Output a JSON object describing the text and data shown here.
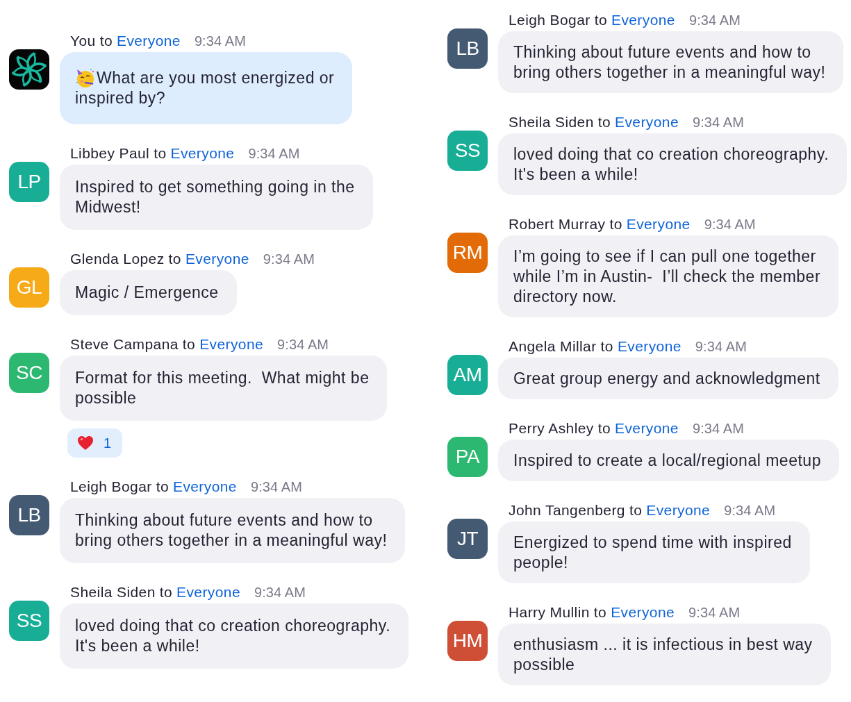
{
  "columns": [
    {
      "messages": [
        {
          "sender": "You",
          "connector": "to",
          "recipient": "Everyone",
          "time": "9:34 AM",
          "own": true,
          "avatar": {
            "kind": "logo"
          },
          "lead_emoji": {
            "kind": "party"
          },
          "lines": [
            "What are you most energized or",
            "inspired by?"
          ]
        },
        {
          "sender": "Libbey Paul",
          "connector": "to",
          "recipient": "Everyone",
          "time": "9:34 AM",
          "own": false,
          "avatar": {
            "kind": "initials",
            "text": "LP",
            "color": "#18ae96"
          },
          "lines": [
            "Inspired to get something going in the",
            "Midwest!"
          ]
        },
        {
          "sender": "Glenda Lopez",
          "connector": "to",
          "recipient": "Everyone",
          "time": "9:34 AM",
          "own": false,
          "avatar": {
            "kind": "initials",
            "text": "GL",
            "color": "#f6aa17"
          },
          "lines": [
            "Magic / Emergence"
          ]
        },
        {
          "sender": "Steve Campana",
          "connector": "to",
          "recipient": "Everyone",
          "time": "9:34 AM",
          "own": false,
          "avatar": {
            "kind": "initials",
            "text": "SC",
            "color": "#2db872"
          },
          "lines": [
            "Format for this meeting.  What might be",
            "possible"
          ],
          "reactions": [
            {
              "kind": "heart",
              "count": "1"
            }
          ]
        },
        {
          "sender": "Leigh Bogar",
          "connector": "to",
          "recipient": "Everyone",
          "time": "9:34 AM",
          "own": false,
          "avatar": {
            "kind": "initials",
            "text": "LB",
            "color": "#445a72"
          },
          "lines": [
            "Thinking about future events and how to",
            "bring others together in a meaningful way!"
          ]
        },
        {
          "sender": "Sheila Siden",
          "connector": "to",
          "recipient": "Everyone",
          "time": "9:34 AM",
          "own": false,
          "avatar": {
            "kind": "initials",
            "text": "SS",
            "color": "#18ae96"
          },
          "lines": [
            "loved doing that co creation choreography.",
            "It's been a while!"
          ]
        }
      ]
    },
    {
      "messages": [
        {
          "sender": "Leigh Bogar",
          "connector": "to",
          "recipient": "Everyone",
          "time": "9:34 AM",
          "own": false,
          "avatar": {
            "kind": "initials",
            "text": "LB",
            "color": "#445a72"
          },
          "lines": [
            "Thinking about future events and how to",
            "bring others together in a meaningful way!"
          ]
        },
        {
          "sender": "Sheila Siden",
          "connector": "to",
          "recipient": "Everyone",
          "time": "9:34 AM",
          "own": false,
          "avatar": {
            "kind": "initials",
            "text": "SS",
            "color": "#18ae96"
          },
          "lines": [
            "loved doing that co creation choreography.",
            "It's been a while!"
          ]
        },
        {
          "sender": "Robert Murray",
          "connector": "to",
          "recipient": "Everyone",
          "time": "9:34 AM",
          "own": false,
          "avatar": {
            "kind": "initials",
            "text": "RM",
            "color": "#e26b07"
          },
          "lines": [
            "I’m going to see if I can pull one together",
            "while I’m in Austin-  I’ll check the member",
            "directory now."
          ]
        },
        {
          "sender": "Angela Millar",
          "connector": "to",
          "recipient": "Everyone",
          "time": "9:34 AM",
          "own": false,
          "avatar": {
            "kind": "initials",
            "text": "AM",
            "color": "#18ae96"
          },
          "lines": [
            "Great group energy and acknowledgment"
          ]
        },
        {
          "sender": "Perry Ashley",
          "connector": "to",
          "recipient": "Everyone",
          "time": "9:34 AM",
          "own": false,
          "avatar": {
            "kind": "initials",
            "text": "PA",
            "color": "#2db872"
          },
          "lines": [
            "Inspired to create a local/regional meetup"
          ]
        },
        {
          "sender": "John Tangenberg",
          "connector": "to",
          "recipient": "Everyone",
          "time": "9:34 AM",
          "own": false,
          "avatar": {
            "kind": "initials",
            "text": "JT",
            "color": "#445a72"
          },
          "lines": [
            "Energized to spend time with inspired",
            "people!"
          ]
        },
        {
          "sender": "Harry Mullin",
          "connector": "to",
          "recipient": "Everyone",
          "time": "9:34 AM",
          "own": false,
          "avatar": {
            "kind": "initials",
            "text": "HM",
            "color": "#cf4f36"
          },
          "lines": [
            "enthusiasm ... it is infectious in best way",
            "possible"
          ]
        }
      ]
    }
  ]
}
